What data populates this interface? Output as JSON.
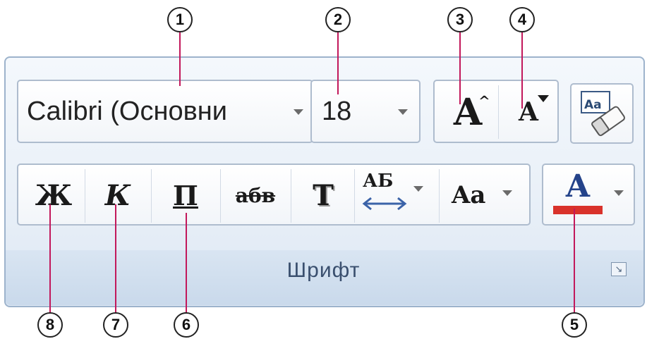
{
  "font_group": {
    "label": "Шрифт",
    "font_name": "Calibri (Основни",
    "font_size": "18",
    "grow_font_icon": "A",
    "shrink_font_icon": "A",
    "bold": "Ж",
    "italic": "К",
    "underline": "П",
    "strikethrough": "абв",
    "shadow": "T",
    "spacing": "АБ",
    "change_case": "Aa",
    "font_color_letter": "A"
  },
  "callouts": [
    "1",
    "2",
    "3",
    "4",
    "5",
    "6",
    "7",
    "8"
  ],
  "colors": {
    "font_color_bar": "#d9322b",
    "callout_line": "#c2185b",
    "panel_border": "#9db3cc"
  },
  "icons": [
    "eraser-icon",
    "spacing-arrows-icon",
    "dialog-launcher-icon"
  ]
}
